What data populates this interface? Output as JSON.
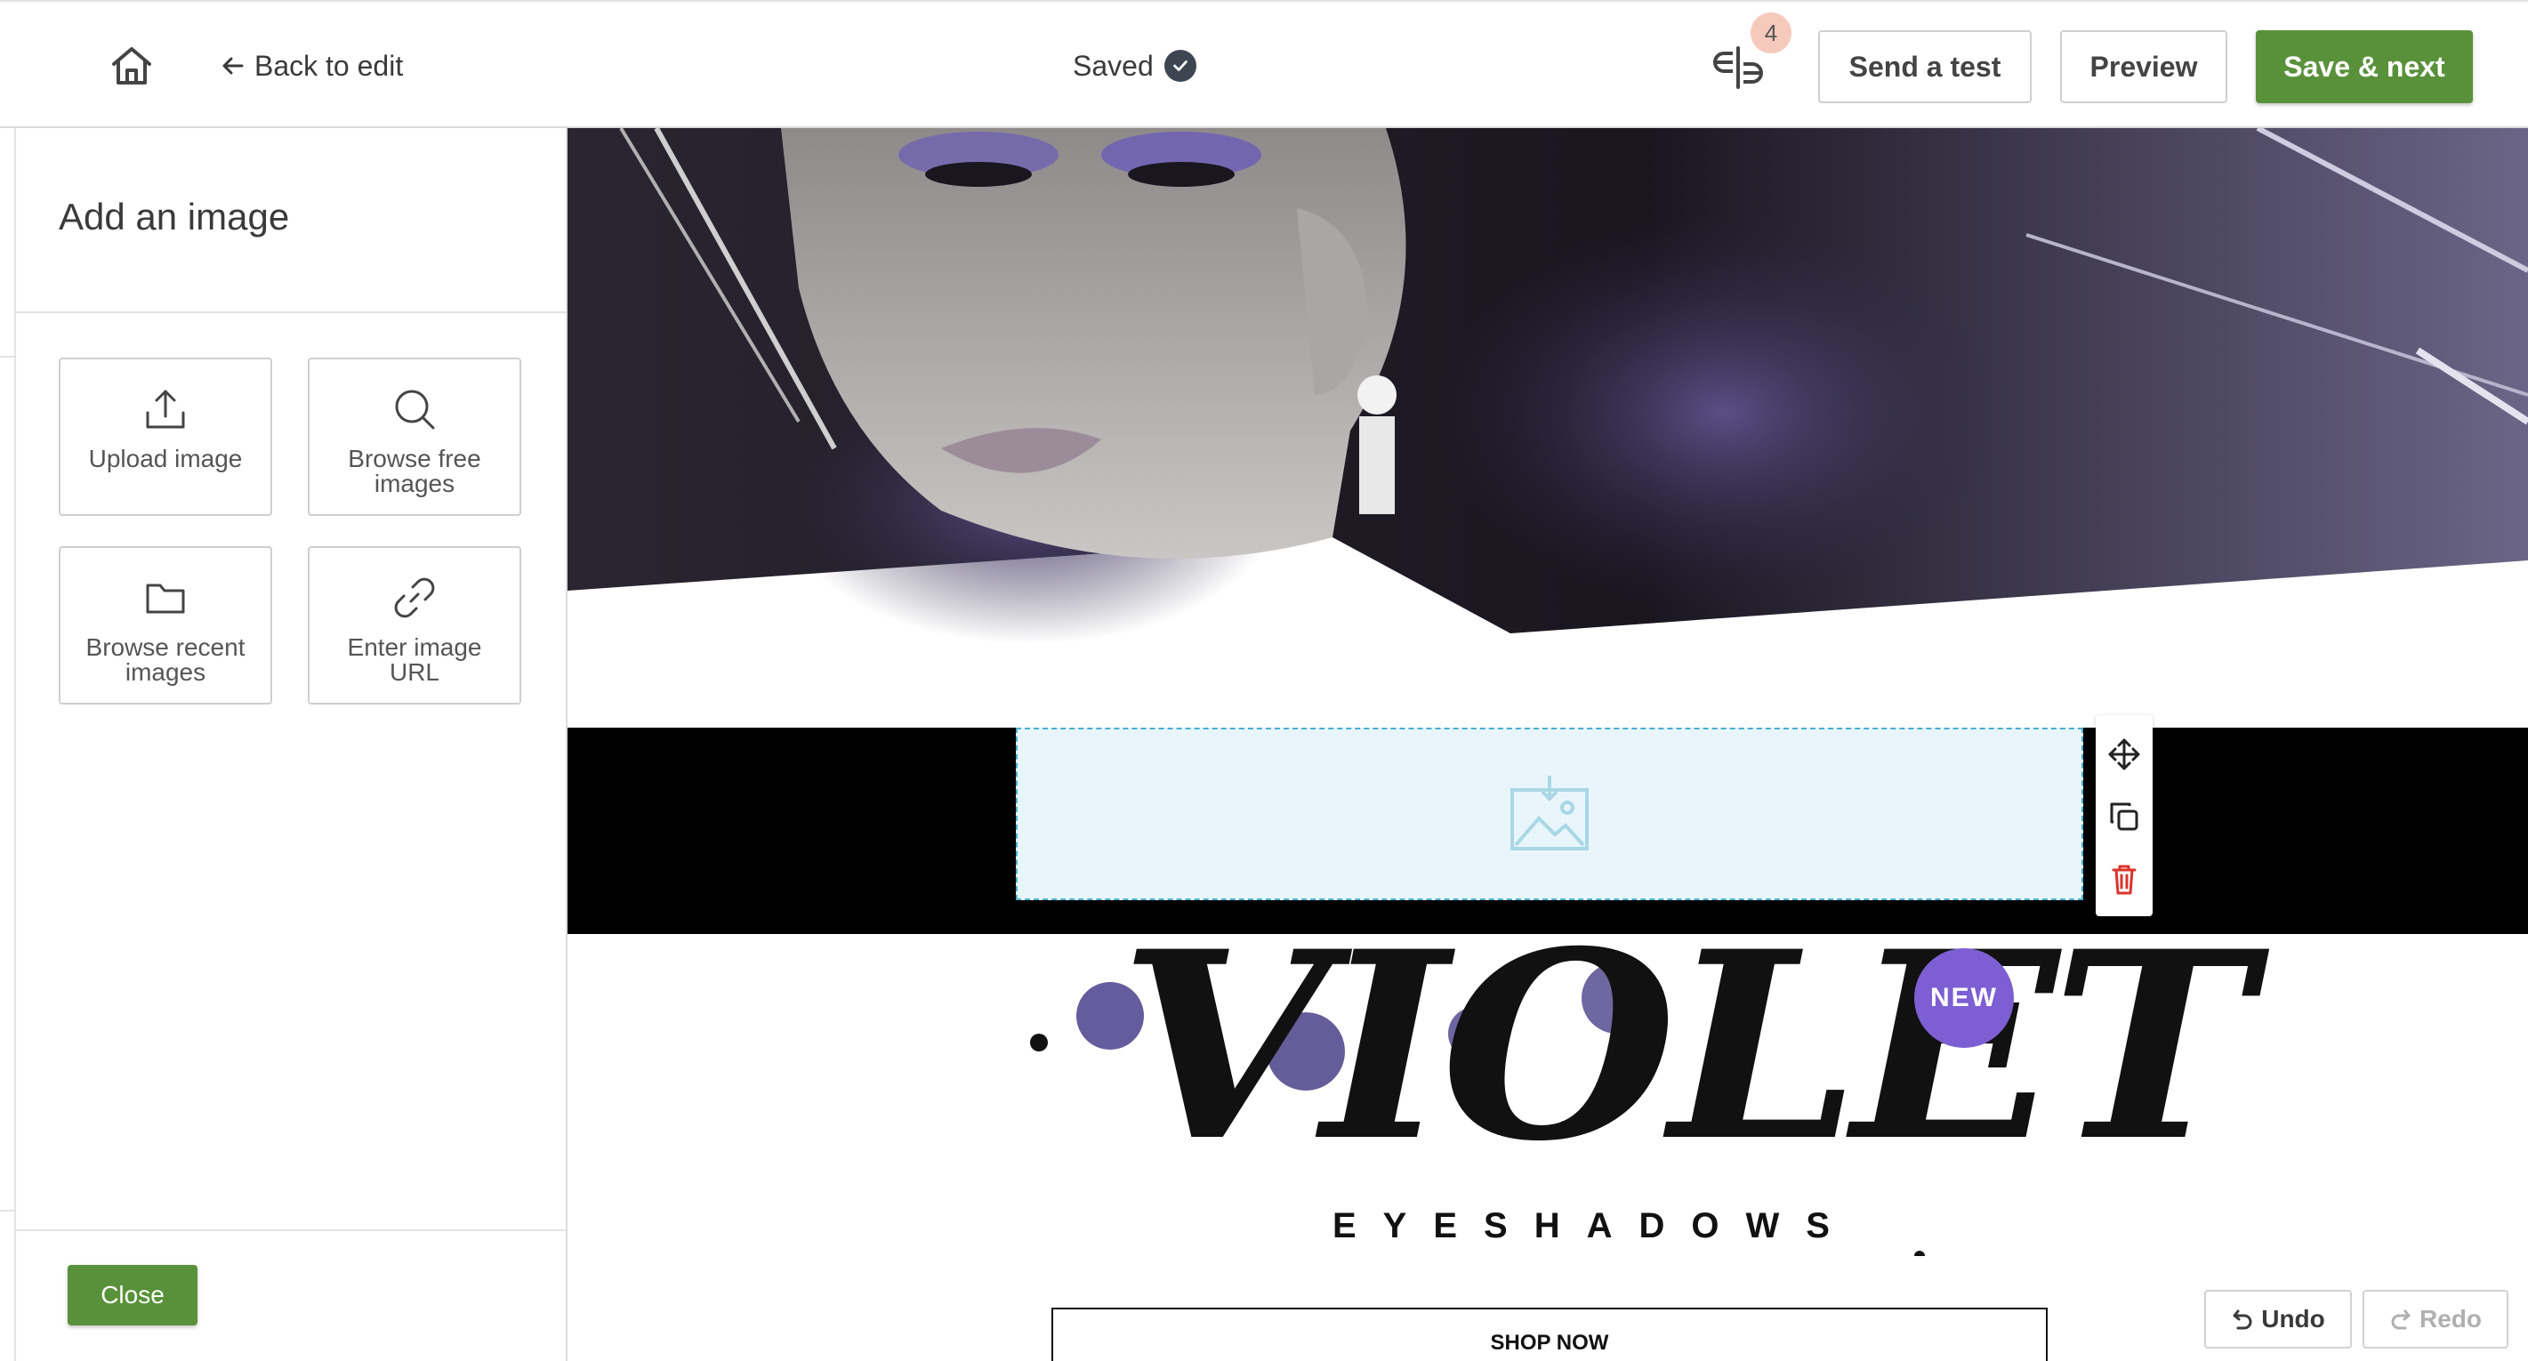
{
  "header": {
    "back_label": "Back to edit",
    "saved_label": "Saved",
    "notification_count": "4",
    "send_test_label": "Send a test",
    "preview_label": "Preview",
    "save_next_label": "Save & next",
    "icons": [
      "home-icon",
      "arrow-left-icon",
      "check-circle-icon",
      "split-view-icon"
    ]
  },
  "panel": {
    "title": "Add an image",
    "options": [
      {
        "label": "Upload image",
        "icon": "upload-icon"
      },
      {
        "label": "Browse free images",
        "icon": "search-icon"
      },
      {
        "label": "Browse recent images",
        "icon": "folder-icon"
      },
      {
        "label": "Enter image URL",
        "icon": "link-icon"
      }
    ],
    "close_label": "Close"
  },
  "canvas": {
    "headline": "VIOLET",
    "badge": "NEW",
    "subheadline": "EYESHADOWS",
    "cta": "SHOP NOW",
    "block_tools": [
      "move-icon",
      "duplicate-icon",
      "delete-icon"
    ]
  },
  "history": {
    "undo_label": "Undo",
    "redo_label": "Redo"
  },
  "colors": {
    "primary_green": "#59913a",
    "accent_violet": "#7d5fd3",
    "placeholder_bg": "#e8f6fb",
    "delete_red": "#d9342b"
  }
}
